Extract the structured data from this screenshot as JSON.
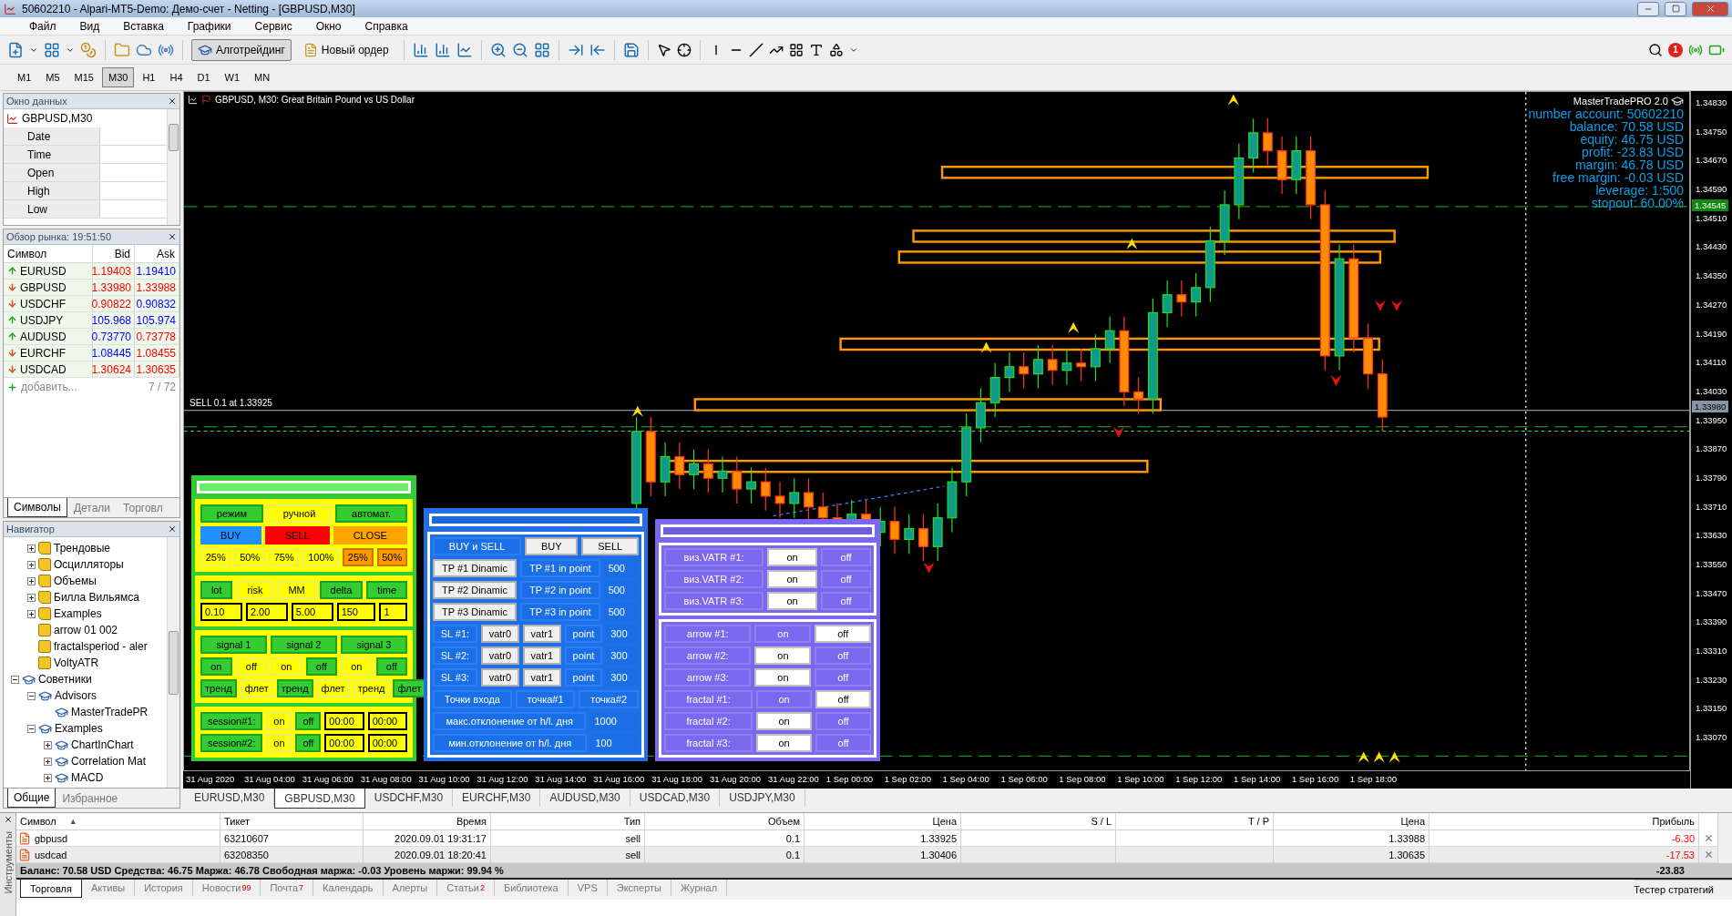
{
  "window": {
    "title": "50602210 - Alpari-MT5-Demo: Демо-счет - Netting - [GBPUSD,M30]"
  },
  "menu": [
    "Файл",
    "Вид",
    "Вставка",
    "Графики",
    "Сервис",
    "Окно",
    "Справка"
  ],
  "toolbar": {
    "buttons": [
      {
        "label": "Алготрейдинг",
        "selected": true
      },
      {
        "label": "Новый ордер",
        "selected": false
      }
    ],
    "notifications": "1"
  },
  "timeframes": [
    {
      "label": "M1",
      "selected": false
    },
    {
      "label": "M5",
      "selected": false
    },
    {
      "label": "M15",
      "selected": false
    },
    {
      "label": "M30",
      "selected": true
    },
    {
      "label": "H1",
      "selected": false
    },
    {
      "label": "H4",
      "selected": false
    },
    {
      "label": "D1",
      "selected": false
    },
    {
      "label": "W1",
      "selected": false
    },
    {
      "label": "MN",
      "selected": false
    }
  ],
  "data_window": {
    "title": "Окно данных",
    "symbol": "GBPUSD,M30",
    "rows": [
      "Date",
      "Time",
      "Open",
      "High",
      "Low"
    ]
  },
  "market_watch": {
    "title": "Обзор рынка: 19:51:50",
    "columns": [
      "Символ",
      "Bid",
      "Ask"
    ],
    "rows": [
      {
        "symbol": "EURUSD",
        "rising": true,
        "bid": "1.19403",
        "bid_up": false,
        "ask": "1.19410",
        "ask_up": true
      },
      {
        "symbol": "GBPUSD",
        "rising": false,
        "bid": "1.33980",
        "bid_up": false,
        "ask": "1.33988",
        "ask_up": false
      },
      {
        "symbol": "USDCHF",
        "rising": false,
        "bid": "0.90822",
        "bid_up": false,
        "ask": "0.90832",
        "ask_up": true
      },
      {
        "symbol": "USDJPY",
        "rising": true,
        "bid": "105.968",
        "bid_up": true,
        "ask": "105.974",
        "ask_up": true
      },
      {
        "symbol": "AUDUSD",
        "rising": true,
        "bid": "0.73770",
        "bid_up": true,
        "ask": "0.73778",
        "ask_up": false
      },
      {
        "symbol": "EURCHF",
        "rising": false,
        "bid": "1.08445",
        "bid_up": true,
        "ask": "1.08455",
        "ask_up": false
      },
      {
        "symbol": "USDCAD",
        "rising": false,
        "bid": "1.30624",
        "bid_up": false,
        "ask": "1.30635",
        "ask_up": false
      }
    ],
    "add_label": "добавить...",
    "count": "7 / 72",
    "tabs": [
      {
        "label": "Символы",
        "selected": true
      },
      {
        "label": "Детали",
        "selected": false
      },
      {
        "label": "Торговл",
        "selected": false
      }
    ]
  },
  "navigator": {
    "title": "Навигатор",
    "items": [
      {
        "children": [
          {
            "label": "Трендовые",
            "kind": "folder",
            "expanded": false
          },
          {
            "label": "Осцилляторы",
            "kind": "folder",
            "expanded": false
          },
          {
            "label": "Объемы",
            "kind": "folder",
            "expanded": false
          },
          {
            "label": "Билла Вильямса",
            "kind": "folder",
            "expanded": false
          },
          {
            "label": "Examples",
            "kind": "folder",
            "expanded": false
          },
          {
            "label": "arrow 01 002",
            "kind": "indicator"
          },
          {
            "label": "fractalsperiod - aler",
            "kind": "indicator"
          },
          {
            "label": "VoltyATR",
            "kind": "indicator"
          }
        ]
      },
      {
        "label": "Советники",
        "kind": "experts",
        "expanded": true,
        "children": [
          {
            "label": "Advisors",
            "kind": "expert-folder",
            "expanded": true,
            "children": [
              {
                "label": "MasterTradePR",
                "kind": "expert"
              }
            ]
          },
          {
            "label": "Examples",
            "kind": "expert-folder",
            "expanded": true,
            "children": [
              {
                "label": "ChartInChart",
                "kind": "expert",
                "expanded": false
              },
              {
                "label": "Correlation Mat",
                "kind": "expert",
                "expanded": false
              },
              {
                "label": "MACD",
                "kind": "expert",
                "expanded": false
              }
            ]
          }
        ]
      }
    ],
    "tabs": [
      {
        "label": "Общие",
        "selected": true
      },
      {
        "label": "Избранное",
        "selected": false
      }
    ]
  },
  "chart": {
    "title": "GBPUSD, M30:  Great Britain Pound vs US Dollar",
    "order_label": "SELL 0.1 at 1.33925",
    "info": {
      "name": "MasterTradePRO 2.0",
      "lines": [
        "number account: 50602210",
        "balance: 70.58 USD",
        "equity: 46.75 USD",
        "profit: -23.83 USD",
        "margin: 46.78 USD",
        "free margin: -0.03 USD",
        "leverage: 1:500",
        "stopout: 60.00%"
      ]
    },
    "price_axis": [
      "1.34830",
      "1.34750",
      "1.34670",
      "1.34590",
      "1.34510",
      "1.34430",
      "1.34350",
      "1.34270",
      "1.34190",
      "1.34110",
      "1.34030",
      "1.33950",
      "1.33870",
      "1.33790",
      "1.33710",
      "1.33630",
      "1.33550",
      "1.33470",
      "1.33390",
      "1.33310",
      "1.33230",
      "1.33150",
      "1.33070"
    ],
    "price_tags": [
      {
        "label": "1.34545",
        "kind": "level"
      },
      {
        "label": "1.33980",
        "kind": "bid"
      }
    ],
    "time_axis": [
      "31 Aug 2020",
      "31 Aug 04:00",
      "31 Aug 06:00",
      "31 Aug 08:00",
      "31 Aug 10:00",
      "31 Aug 12:00",
      "31 Aug 14:00",
      "31 Aug 16:00",
      "31 Aug 18:00",
      "31 Aug 20:00",
      "31 Aug 22:00",
      "1 Sep 00:00",
      "1 Sep 02:00",
      "1 Sep 04:00",
      "1 Sep 06:00",
      "1 Sep 08:00",
      "1 Sep 10:00",
      "1 Sep 12:00",
      "1 Sep 14:00",
      "1 Sep 16:00",
      "1 Sep 18:00"
    ]
  },
  "panels": [
    {
      "kind": "trade",
      "sections": [
        {
          "rows": [
            [
              {
                "kind": "toggle",
                "label": "режим",
                "selected": true
              },
              {
                "kind": "toggle",
                "label": "ручной",
                "selected": false
              },
              {
                "kind": "toggle",
                "label": "автомат.",
                "selected": true
              }
            ],
            [
              {
                "kind": "buy",
                "label": "BUY"
              },
              {
                "kind": "sell",
                "label": "SELL"
              },
              {
                "kind": "close",
                "label": "CLOSE"
              }
            ],
            [
              {
                "kind": "toggle",
                "label": "25%",
                "selected": false
              },
              {
                "kind": "toggle",
                "label": "50%",
                "selected": false
              },
              {
                "kind": "toggle",
                "label": "75%",
                "selected": false
              },
              {
                "kind": "toggle",
                "label": "100%",
                "selected": false
              },
              {
                "kind": "close_part",
                "label": "25%"
              },
              {
                "kind": "close_part",
                "label": "50%"
              }
            ]
          ]
        },
        {
          "rows": [
            [
              {
                "kind": "toggle",
                "label": "lot",
                "selected": true
              },
              {
                "kind": "toggle",
                "label": "risk",
                "selected": false
              },
              {
                "kind": "toggle",
                "label": "MM",
                "selected": false
              },
              {
                "kind": "toggle",
                "label": "delta",
                "selected": true
              },
              {
                "kind": "toggle",
                "label": "time",
                "selected": true
              }
            ],
            [
              {
                "kind": "field",
                "label": "0.10"
              },
              {
                "kind": "field",
                "label": "2.00"
              },
              {
                "kind": "field",
                "label": "5.00"
              },
              {
                "kind": "field",
                "label": "150"
              },
              {
                "kind": "field",
                "label": "1"
              }
            ]
          ]
        },
        {
          "rows": [
            [
              {
                "kind": "toggle",
                "label": "signal 1",
                "selected": true
              },
              {
                "kind": "toggle",
                "label": "signal 2",
                "selected": true
              },
              {
                "kind": "toggle",
                "label": "signal 3",
                "selected": true
              }
            ],
            [
              {
                "kind": "toggle",
                "label": "on",
                "selected": true
              },
              {
                "kind": "toggle",
                "label": "off",
                "selected": false
              },
              {
                "kind": "toggle",
                "label": "on",
                "selected": false
              },
              {
                "kind": "toggle",
                "label": "off",
                "selected": true
              },
              {
                "kind": "toggle",
                "label": "on",
                "selected": false
              },
              {
                "kind": "toggle",
                "label": "off",
                "selected": true
              }
            ],
            [
              {
                "kind": "toggle",
                "label": "тренд",
                "selected": true
              },
              {
                "kind": "toggle",
                "label": "флет",
                "selected": false
              },
              {
                "kind": "toggle",
                "label": "тренд",
                "selected": true
              },
              {
                "kind": "toggle",
                "label": "флет",
                "selected": false
              },
              {
                "kind": "toggle",
                "label": "тренд",
                "selected": false
              },
              {
                "kind": "toggle",
                "label": "флет",
                "selected": true
              }
            ]
          ]
        },
        {
          "rows": [
            [
              {
                "kind": "label",
                "label": "session#1:"
              },
              {
                "kind": "toggle",
                "label": "on",
                "selected": false
              },
              {
                "kind": "toggle",
                "label": "off",
                "selected": true
              },
              {
                "kind": "field",
                "label": "00:00"
              },
              {
                "kind": "field",
                "label": "00:00"
              }
            ],
            [
              {
                "kind": "label",
                "label": "session#2:"
              },
              {
                "kind": "toggle",
                "label": "on",
                "selected": false
              },
              {
                "kind": "toggle",
                "label": "off",
                "selected": true
              },
              {
                "kind": "field",
                "label": "00:00"
              },
              {
                "kind": "field",
                "label": "00:00"
              }
            ]
          ]
        }
      ]
    },
    {
      "kind": "tpsl",
      "sections": [
        {
          "rows": [
            [
              {
                "kind": "toggle",
                "label": "BUY и SELL",
                "selected": true
              },
              {
                "kind": "toggle",
                "label": "BUY",
                "selected": false
              },
              {
                "kind": "toggle",
                "label": "SELL",
                "selected": false
              }
            ],
            [
              {
                "kind": "toggle",
                "label": "TP #1 Dinamic",
                "selected": false
              },
              {
                "kind": "toggle",
                "label": "TP #1 in point",
                "selected": true
              },
              {
                "kind": "field",
                "label": "500"
              }
            ],
            [
              {
                "kind": "toggle",
                "label": "TP #2 Dinamic",
                "selected": false
              },
              {
                "kind": "toggle",
                "label": "TP #2 in point",
                "selected": true
              },
              {
                "kind": "field",
                "label": "500"
              }
            ],
            [
              {
                "kind": "toggle",
                "label": "TP #3 Dinamic",
                "selected": false
              },
              {
                "kind": "toggle",
                "label": "TP #3 in point",
                "selected": true
              },
              {
                "kind": "field",
                "label": "500"
              }
            ],
            [
              {
                "kind": "label",
                "label": "SL #1:"
              },
              {
                "kind": "toggle",
                "label": "vatr0",
                "selected": false
              },
              {
                "kind": "toggle",
                "label": "vatr1",
                "selected": false
              },
              {
                "kind": "toggle",
                "label": "point",
                "selected": true
              },
              {
                "kind": "field",
                "label": "300"
              }
            ],
            [
              {
                "kind": "label",
                "label": "SL #2:"
              },
              {
                "kind": "toggle",
                "label": "vatr0",
                "selected": false
              },
              {
                "kind": "toggle",
                "label": "vatr1",
                "selected": false
              },
              {
                "kind": "toggle",
                "label": "point",
                "selected": true
              },
              {
                "kind": "field",
                "label": "300"
              }
            ],
            [
              {
                "kind": "label",
                "label": "SL #3:"
              },
              {
                "kind": "toggle",
                "label": "vatr0",
                "selected": false
              },
              {
                "kind": "toggle",
                "label": "vatr1",
                "selected": false
              },
              {
                "kind": "toggle",
                "label": "point",
                "selected": true
              },
              {
                "kind": "field",
                "label": "300"
              }
            ],
            [
              {
                "kind": "toggle",
                "label": "Точки входа",
                "selected": true
              },
              {
                "kind": "toggle",
                "label": "точка#1",
                "selected": true
              },
              {
                "kind": "toggle",
                "label": "точка#2",
                "selected": true
              }
            ],
            [
              {
                "kind": "label",
                "label": "макс.отклонение от h/l. дня"
              },
              {
                "kind": "field",
                "label": "1000"
              }
            ],
            [
              {
                "kind": "label",
                "label": "мин.отклонение от h/l. дня"
              },
              {
                "kind": "field",
                "label": "100"
              }
            ]
          ]
        }
      ]
    },
    {
      "kind": "indicator",
      "sections": [
        {
          "rows": [
            [
              {
                "kind": "label",
                "label": "виз.VATR #1:"
              },
              {
                "kind": "toggle",
                "label": "on",
                "selected": true
              },
              {
                "kind": "toggle",
                "label": "off",
                "selected": false
              }
            ],
            [
              {
                "kind": "label",
                "label": "виз.VATR #2:"
              },
              {
                "kind": "toggle",
                "label": "on",
                "selected": true
              },
              {
                "kind": "toggle",
                "label": "off",
                "selected": false
              }
            ],
            [
              {
                "kind": "label",
                "label": "виз.VATR #3:"
              },
              {
                "kind": "toggle",
                "label": "on",
                "selected": true
              },
              {
                "kind": "toggle",
                "label": "off",
                "selected": false
              }
            ]
          ]
        },
        {
          "rows": [
            [
              {
                "kind": "label",
                "label": "arrow #1:"
              },
              {
                "kind": "toggle",
                "label": "on",
                "selected": false
              },
              {
                "kind": "toggle",
                "label": "off",
                "selected": true
              }
            ],
            [
              {
                "kind": "label",
                "label": "arrow #2:"
              },
              {
                "kind": "toggle",
                "label": "on",
                "selected": true
              },
              {
                "kind": "toggle",
                "label": "off",
                "selected": false
              }
            ],
            [
              {
                "kind": "label",
                "label": "arrow #3:"
              },
              {
                "kind": "toggle",
                "label": "on",
                "selected": true
              },
              {
                "kind": "toggle",
                "label": "off",
                "selected": false
              }
            ],
            [
              {
                "kind": "label",
                "label": "fractal #1:"
              },
              {
                "kind": "toggle",
                "label": "on",
                "selected": false
              },
              {
                "kind": "toggle",
                "label": "off",
                "selected": true
              }
            ],
            [
              {
                "kind": "label",
                "label": "fractal #2:"
              },
              {
                "kind": "toggle",
                "label": "on",
                "selected": true
              },
              {
                "kind": "toggle",
                "label": "off",
                "selected": false
              }
            ],
            [
              {
                "kind": "label",
                "label": "fractal #3:"
              },
              {
                "kind": "toggle",
                "label": "on",
                "selected": true
              },
              {
                "kind": "toggle",
                "label": "off",
                "selected": false
              }
            ]
          ]
        }
      ]
    }
  ],
  "chart_tabs": [
    {
      "label": "EURUSD,M30",
      "selected": false
    },
    {
      "label": "GBPUSD,M30",
      "selected": true
    },
    {
      "label": "USDCHF,M30",
      "selected": false
    },
    {
      "label": "EURCHF,M30",
      "selected": false
    },
    {
      "label": "AUDUSD,M30",
      "selected": false
    },
    {
      "label": "USDCAD,M30",
      "selected": false
    },
    {
      "label": "USDJPY,M30",
      "selected": false
    }
  ],
  "terminal": {
    "side_label": "Инструменты",
    "sort_mark": "▲",
    "columns": [
      "Символ",
      "Тикет",
      "Время",
      "Тип",
      "Объем",
      "Цена",
      "S / L",
      "T / P",
      "Цена",
      "Прибыль"
    ],
    "rows": [
      {
        "symbol": "gbpusd",
        "ticket": "63210607",
        "time": "2020.09.01 19:31:17",
        "type": "sell",
        "volume": "0.1",
        "price": "1.33925",
        "current": "1.33988",
        "profit": "-6.30"
      },
      {
        "symbol": "usdcad",
        "ticket": "63208350",
        "time": "2020.09.01 18:20:41",
        "type": "sell",
        "volume": "0.1",
        "price": "1.30406",
        "current": "1.30635",
        "profit": "-17.53"
      }
    ],
    "summary": "Баланс: 70.58 USD  Средства: 46.75  Маржа: 46.78  Свободная маржа: -0.03  Уровень маржи: 99.94 %",
    "total": "-23.83",
    "tabs": [
      {
        "label": "Торговля",
        "selected": true
      },
      {
        "label": "Активы",
        "selected": false
      },
      {
        "label": "История",
        "selected": false
      },
      {
        "label": "Новости",
        "count": "99",
        "selected": false
      },
      {
        "label": "Почта",
        "count": "7",
        "selected": false
      },
      {
        "label": "Календарь",
        "selected": false
      },
      {
        "label": "Алерты",
        "selected": false
      },
      {
        "label": "Статьи",
        "count": "2",
        "selected": false
      },
      {
        "label": "Библиотека",
        "selected": false
      },
      {
        "label": "VPS",
        "selected": false
      },
      {
        "label": "Эксперты",
        "selected": false
      },
      {
        "label": "Журнал",
        "selected": false
      }
    ],
    "tester": "Тестер стратегий"
  }
}
